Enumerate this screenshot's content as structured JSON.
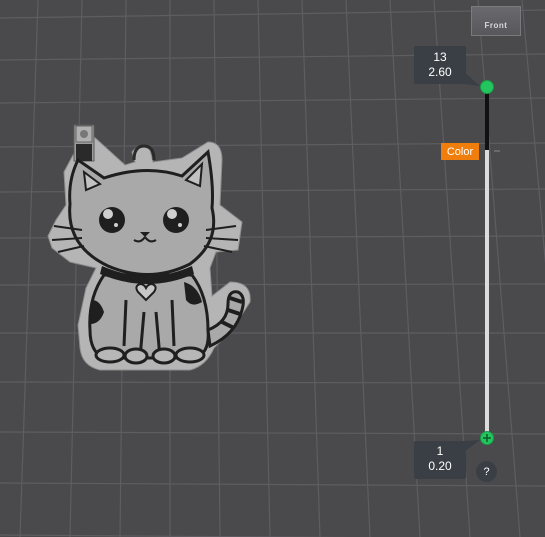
{
  "view_cube": {
    "label": "Front"
  },
  "layer_slider": {
    "top": {
      "layer": "13",
      "height": "2.60"
    },
    "bottom": {
      "layer": "1",
      "height": "0.20"
    },
    "color_tag": "Color",
    "help_label": "?",
    "colors": {
      "handle": "#23c55e",
      "track_upper": "#111111",
      "track_lower": "#dcdcdc",
      "tag": "#f07e0c"
    }
  },
  "model": {
    "name": "cat-keychain",
    "colors": {
      "plate": "#b5b5b5",
      "outline": "#1f1f1f",
      "body": "#a9a9a9"
    }
  },
  "scene": {
    "background": "#4a4a4d",
    "grid_line": "#5e5e62"
  }
}
